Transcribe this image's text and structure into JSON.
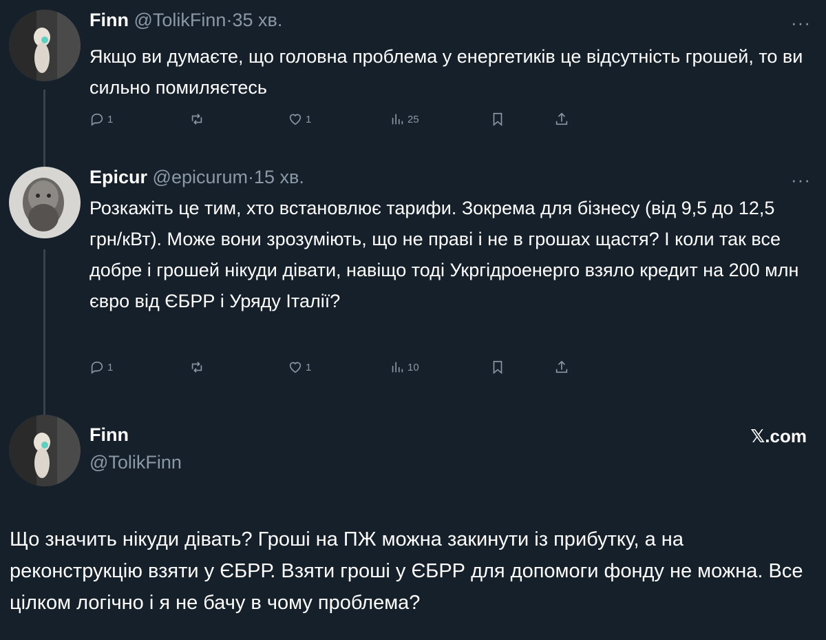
{
  "tweets": [
    {
      "name": "Finn",
      "handle": "@TolikFinn",
      "sep": "·",
      "time": "35 хв.",
      "more": "···",
      "text": "Якщо ви думаєте, що головна проблема у енергетиків це відсутність грошей, то ви сильно помиляєтесь",
      "replies": "1",
      "likes": "1",
      "views": "25",
      "avatar_icon": "figure-avatar"
    },
    {
      "name": "Epicur",
      "handle": "@epicurum",
      "sep": "·",
      "time": "15 хв.",
      "more": "···",
      "text": "Розкажіть це тим, хто встановлює тарифи. Зокрема для бізнесу (від 9,5 до 12,5 грн/кВт). Може вони зрозуміють, що не праві і не в грошах щастя? І коли так все добре і грошей нікуди дівати, навіщо тоді Укргідроенерго взяло кредит на 200 млн євро від ЄБРР і Уряду Італії?",
      "replies": "1",
      "likes": "1",
      "views": "10",
      "avatar_icon": "bust-avatar"
    }
  ],
  "main": {
    "name": "Finn",
    "handle": "@TolikFinn",
    "brand": "𝕏.com",
    "text": "Що значить нікуди дівать? Гроші на ПЖ можна закинути із прибутку, а на реконструкцію взяти у ЄБРР. Взяти гроші у ЄБРР для допомоги фонду не можна. Все цілком логічно і я не бачу в чому проблема?"
  },
  "colors": {
    "background": "#15202b",
    "muted": "#8b98a5",
    "text": "#ffffff",
    "thread_line": "#38444d"
  },
  "icons": [
    "reply-icon",
    "retweet-icon",
    "like-icon",
    "views-icon",
    "bookmark-icon",
    "share-icon"
  ]
}
